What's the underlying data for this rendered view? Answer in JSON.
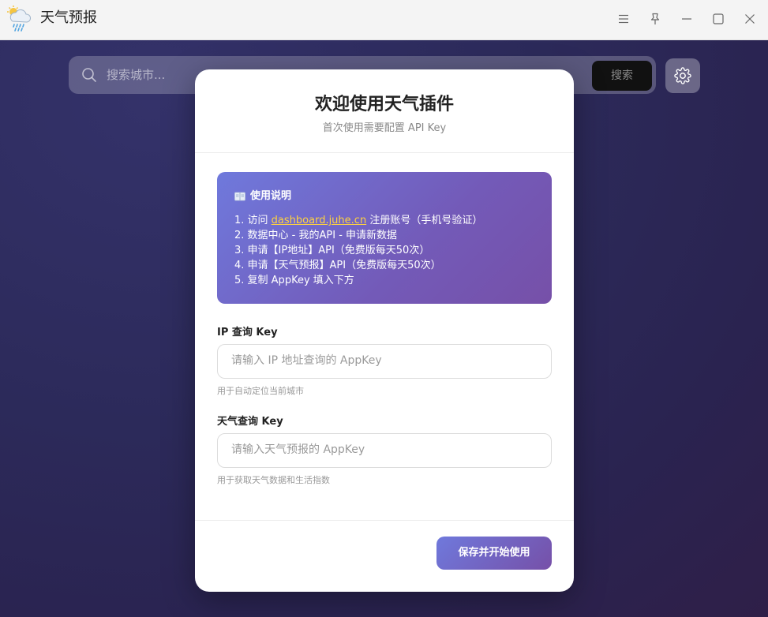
{
  "window": {
    "title": "天气预报",
    "icon": "weather-cloud-rain-sun-icon"
  },
  "search": {
    "placeholder": "搜索城市...",
    "button_label": "搜索"
  },
  "modal": {
    "title": "欢迎使用天气插件",
    "subtitle": "首次使用需要配置 API Key",
    "info": {
      "heading": "使用说明",
      "heading_icon": "book-icon",
      "steps": [
        {
          "prefix": "1. 访问 ",
          "link": "dashboard.juhe.cn",
          "suffix": " 注册账号（手机号验证）"
        },
        {
          "text": "2. 数据中心 - 我的API - 申请新数据"
        },
        {
          "text": "3. 申请【IP地址】API（免费版每天50次）"
        },
        {
          "text": "4. 申请【天气预报】API（免费版每天50次）"
        },
        {
          "text": "5. 复制 AppKey 填入下方"
        }
      ]
    },
    "fields": [
      {
        "label": "IP 查询 Key",
        "placeholder": "请输入 IP 地址查询的 AppKey",
        "hint": "用于自动定位当前城市"
      },
      {
        "label": "天气查询 Key",
        "placeholder": "请输入天气预报的 AppKey",
        "hint": "用于获取天气数据和生活指数"
      }
    ],
    "save_button": "保存并开始使用"
  },
  "colors": {
    "accent_start": "#6f79dc",
    "accent_end": "#7650a8",
    "link": "#ffd23f",
    "background": "#2a2752"
  }
}
